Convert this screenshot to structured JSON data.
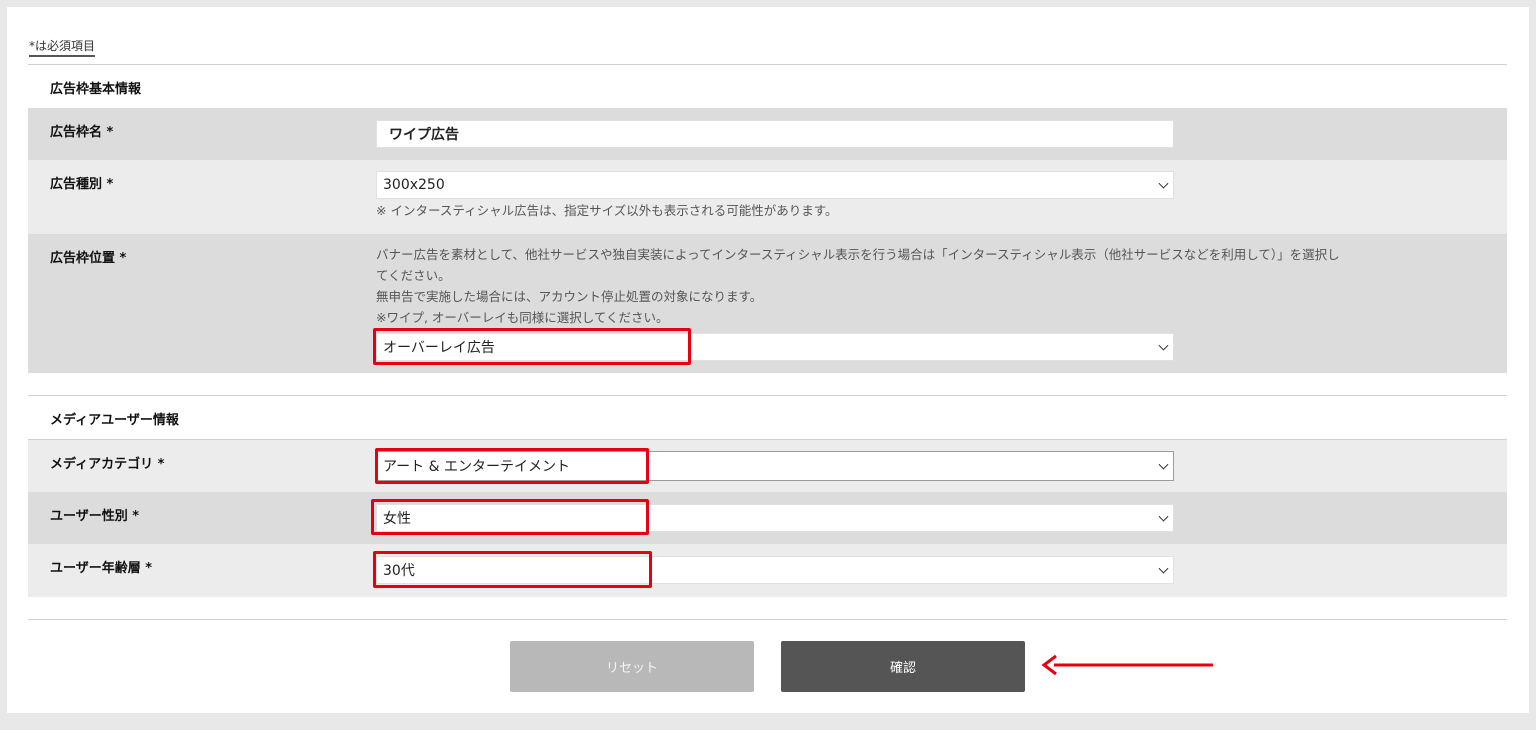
{
  "required_note": "*は必須項目",
  "section_basic": {
    "title": "広告枠基本情報",
    "name": {
      "label": "広告枠名 *",
      "value": "ワイプ広告"
    },
    "type": {
      "label": "広告種別 *",
      "value": "300x250",
      "note": "※ インタースティシャル広告は、指定サイズ以外も表示される可能性があります。"
    },
    "position": {
      "label": "広告枠位置 *",
      "note_lines": [
        "バナー広告を素材として、他社サービスや独自実装によってインタースティシャル表示を行う場合は「インタースティシャル表示（他社サービスなどを利用して）」を選択し",
        "てください。",
        "無申告で実施した場合には、アカウント停止処置の対象になります。",
        "※ワイプ, オーバーレイも同様に選択してください。"
      ],
      "value": "オーバーレイ広告"
    }
  },
  "section_media": {
    "title": "メディアユーザー情報",
    "category": {
      "label": "メディアカテゴリ *",
      "value": "アート & エンターテイメント"
    },
    "gender": {
      "label": "ユーザー性別 *",
      "value": "女性"
    },
    "age": {
      "label": "ユーザー年齢層 *",
      "value": "30代"
    }
  },
  "buttons": {
    "reset": "リセット",
    "confirm": "確認"
  },
  "colors": {
    "highlight": "#e60012",
    "confirm_bg": "#555555",
    "reset_bg": "#b8b8b8"
  }
}
